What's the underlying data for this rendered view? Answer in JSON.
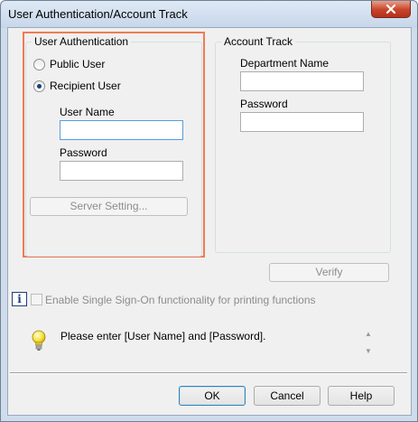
{
  "window": {
    "title": "User Authentication/Account Track"
  },
  "user_auth": {
    "group_label": "User Authentication",
    "public_user_label": "Public User",
    "recipient_user_label": "Recipient User",
    "selected": "Recipient User",
    "username_label": "User Name",
    "username_value": "",
    "password_label": "Password",
    "password_value": "",
    "server_setting_label": "Server Setting..."
  },
  "account_track": {
    "group_label": "Account Track",
    "department_label": "Department Name",
    "department_value": "",
    "password_label": "Password",
    "password_value": ""
  },
  "verify_label": "Verify",
  "sso": {
    "label": "Enable Single Sign-On functionality for printing functions",
    "checked": false
  },
  "message": {
    "text": "Please enter [User Name] and [Password]."
  },
  "footer": {
    "ok_label": "OK",
    "cancel_label": "Cancel",
    "help_label": "Help"
  },
  "icons": {
    "close": "close-icon",
    "info": "info-icon",
    "bulb": "lightbulb-icon"
  },
  "colors": {
    "highlight_border": "#f07b53",
    "close_button": "#c8432a"
  }
}
